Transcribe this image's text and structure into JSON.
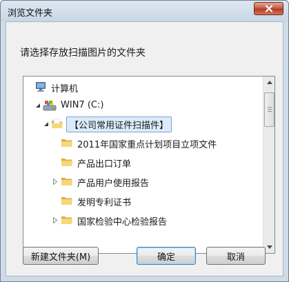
{
  "window": {
    "title": "浏览文件夹"
  },
  "instruction": "请选择存放扫描图片的文件夹",
  "tree": {
    "nodes": [
      {
        "label": "计算机",
        "icon": "computer-icon",
        "expand": "none"
      },
      {
        "label": "WIN7 (C:)",
        "icon": "drive-icon",
        "expand": "expanded"
      },
      {
        "label": "【公司常用证件扫描件】",
        "icon": "folder-icon",
        "expand": "expanded",
        "selected": true
      },
      {
        "label": "2011年国家重点计划项目立项文件",
        "icon": "folder-icon",
        "expand": "none"
      },
      {
        "label": "产品出口订单",
        "icon": "folder-icon",
        "expand": "none"
      },
      {
        "label": "产品用户使用报告",
        "icon": "folder-icon",
        "expand": "collapsed"
      },
      {
        "label": "发明专利证书",
        "icon": "folder-icon",
        "expand": "none"
      },
      {
        "label": "国家检验中心检验报告",
        "icon": "folder-icon",
        "expand": "collapsed"
      }
    ]
  },
  "buttons": {
    "new_folder": "新建文件夹(M)",
    "ok": "确定",
    "cancel": "取消"
  },
  "colors": {
    "selection_bg": "#dcebfc",
    "selection_border": "#7da2ce",
    "close_button": "#c4563f"
  }
}
